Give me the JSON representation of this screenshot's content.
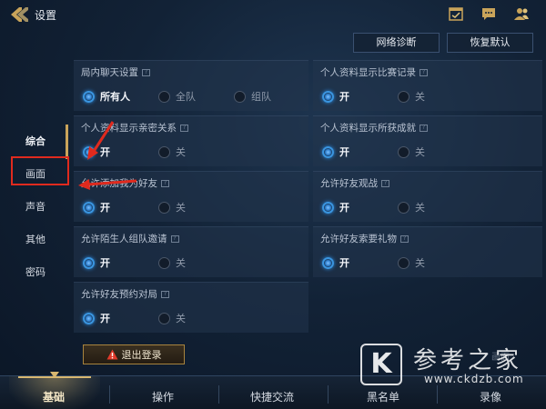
{
  "header": {
    "title": "设置"
  },
  "actions": {
    "network": "网络诊断",
    "restore": "恢复默认"
  },
  "sidebar": {
    "items": [
      "综合",
      "画面",
      "声音",
      "其他",
      "密码"
    ],
    "active": "综合"
  },
  "panels": [
    {
      "title": "局内聊天设置",
      "options": [
        "所有人",
        "全队",
        "组队"
      ],
      "selected": 0
    },
    {
      "title": "个人资料显示比赛记录",
      "options": [
        "开",
        "关"
      ],
      "selected": 0
    },
    {
      "title": "个人资料显示亲密关系",
      "options": [
        "开",
        "关"
      ],
      "selected": 0
    },
    {
      "title": "个人资料显示所获成就",
      "options": [
        "开",
        "关"
      ],
      "selected": 0
    },
    {
      "title": "允许添加我为好友",
      "options": [
        "开",
        "关"
      ],
      "selected": 0
    },
    {
      "title": "允许好友观战",
      "options": [
        "开",
        "关"
      ],
      "selected": 0
    },
    {
      "title": "允许陌生人组队邀请",
      "options": [
        "开",
        "关"
      ],
      "selected": 0
    },
    {
      "title": "允许好友索要礼物",
      "options": [
        "开",
        "关"
      ],
      "selected": 0
    },
    {
      "title": "允许好友预约对局",
      "options": [
        "开",
        "关"
      ],
      "selected": 0
    }
  ],
  "logout": {
    "label": "退出登录"
  },
  "bottom_tabs": {
    "items": [
      "基础",
      "操作",
      "快捷交流",
      "黑名单",
      "录像"
    ],
    "active": "基础"
  },
  "watermark": {
    "logo": "K",
    "name": "参考之家",
    "url": "www.ckdzb.com"
  },
  "partial_text": "画面",
  "colors": {
    "accent": "#3a95e0",
    "gold": "#c9a45a",
    "annotation": "#e02a1e"
  },
  "icons": [
    "back-arrow-icon",
    "calendar-check-icon",
    "chat-icon",
    "friends-icon",
    "warning-icon"
  ]
}
